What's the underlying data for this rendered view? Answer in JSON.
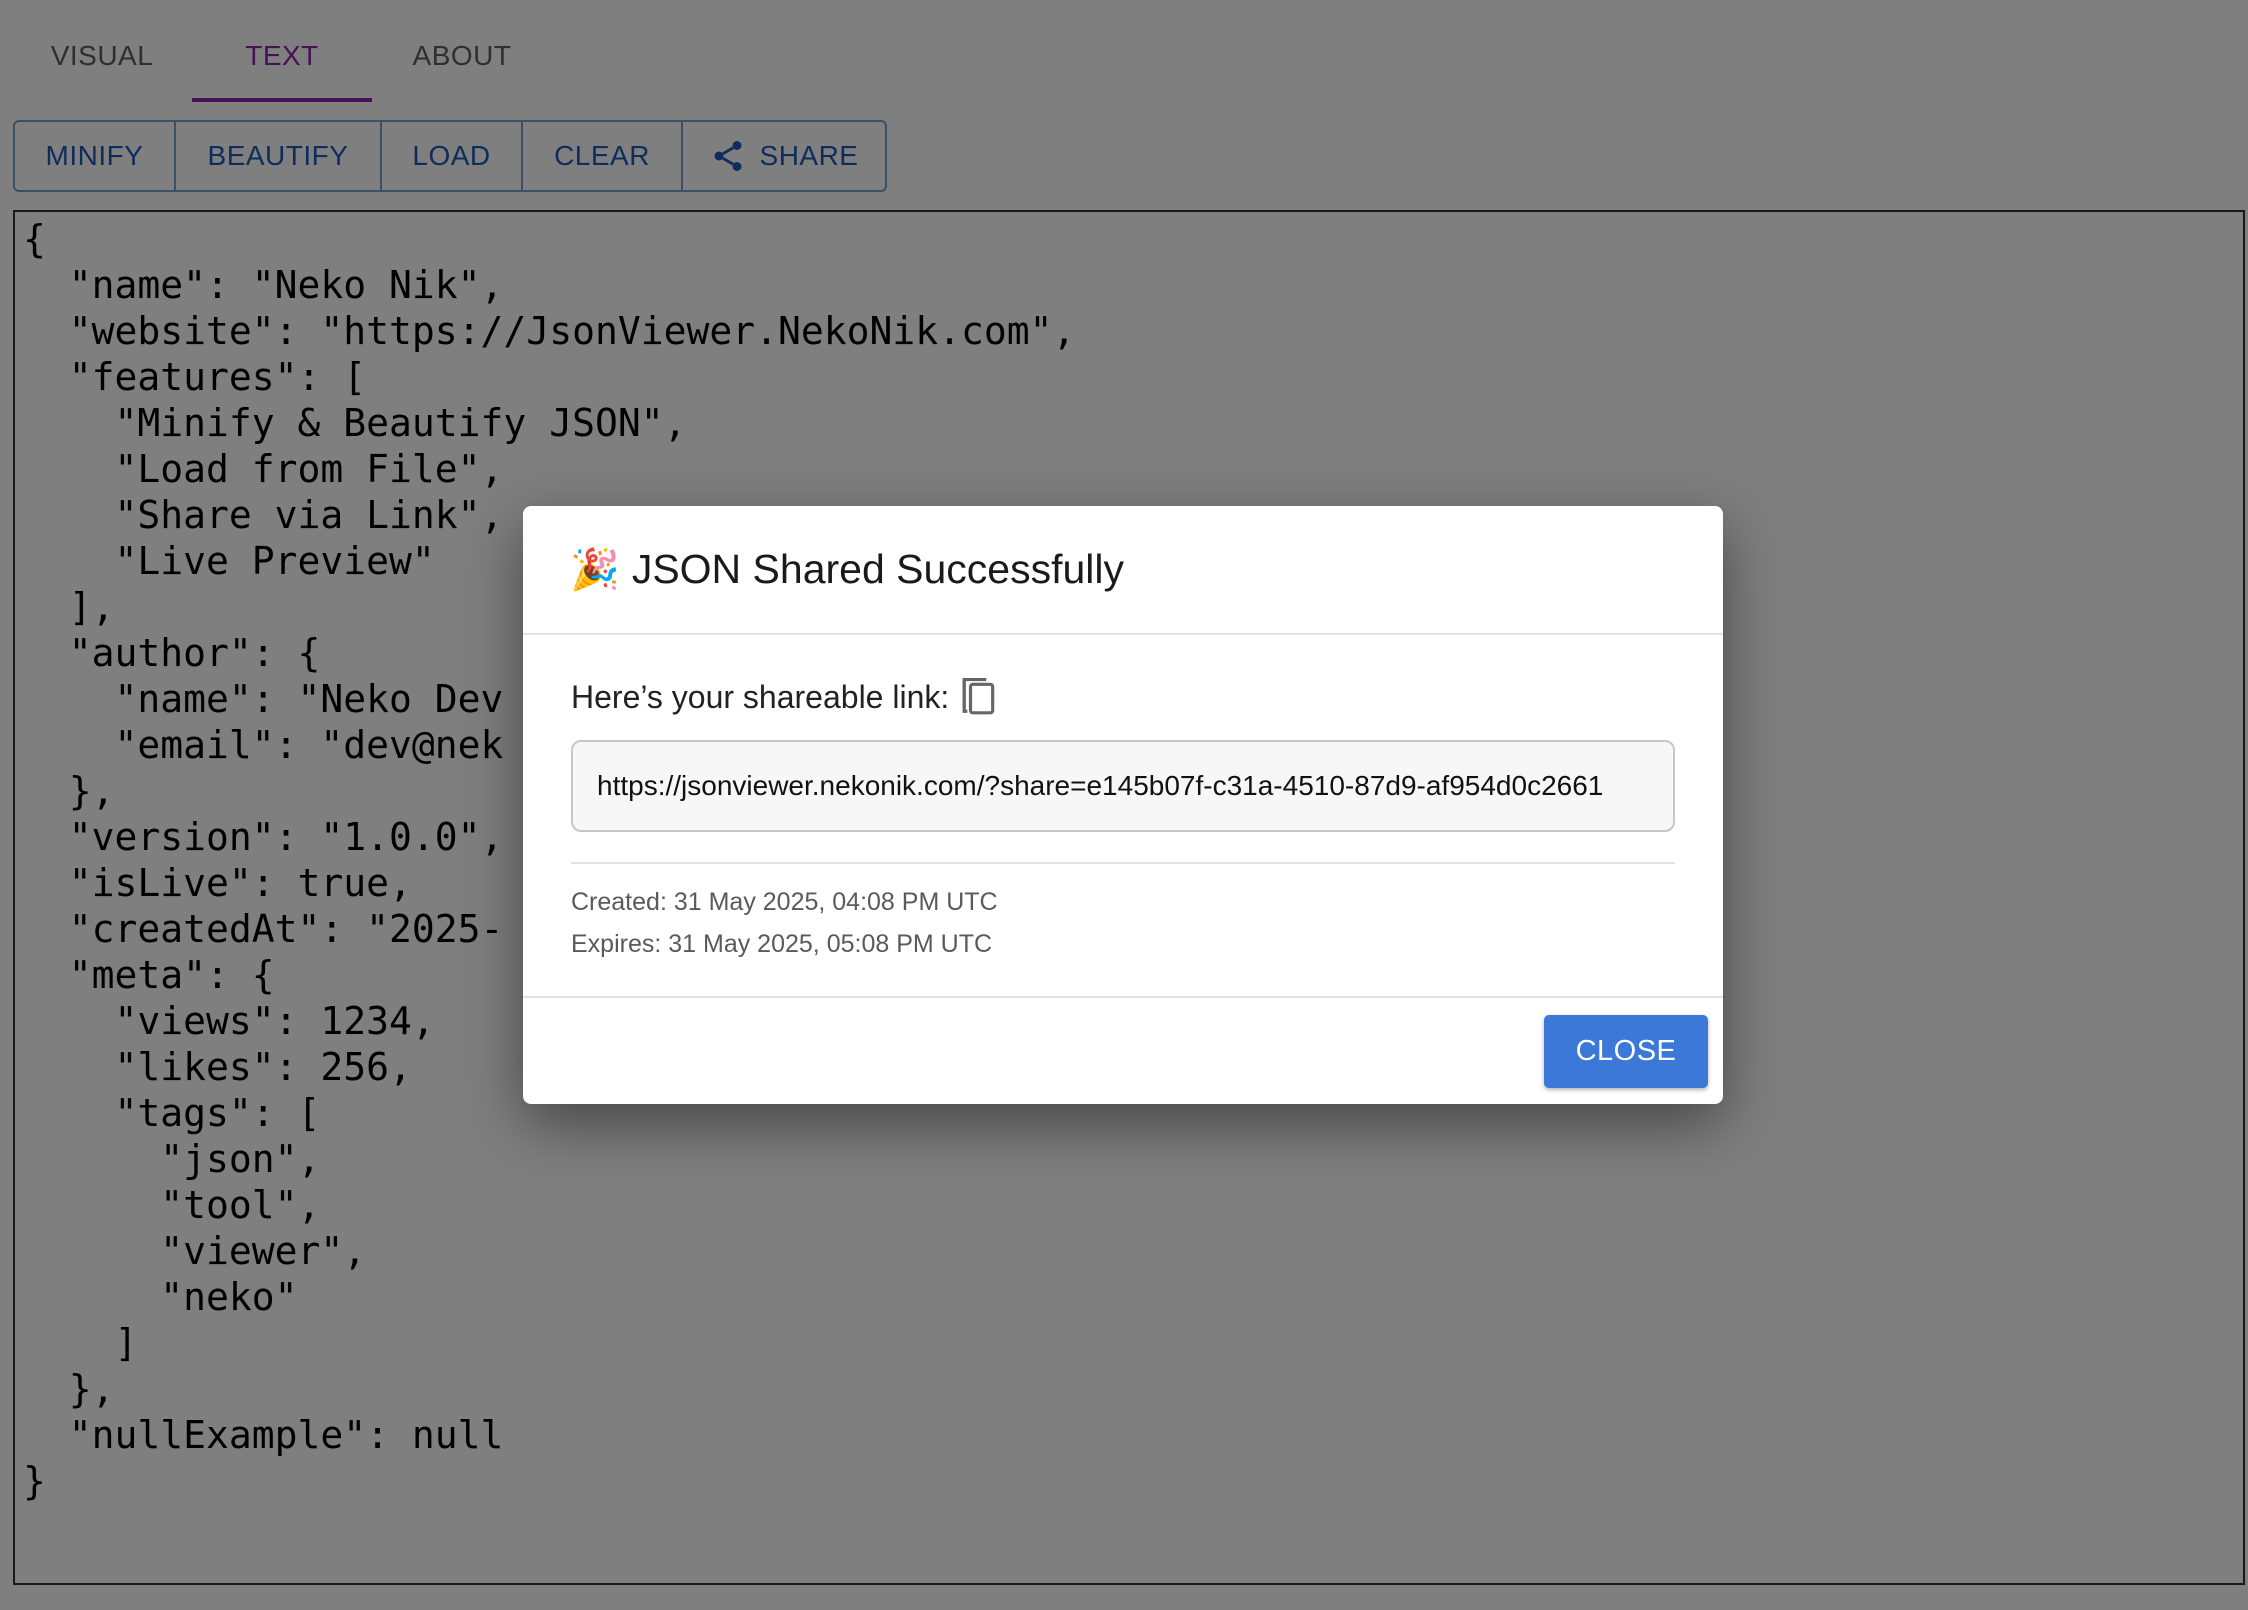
{
  "tabs": [
    {
      "label": "VISUAL"
    },
    {
      "label": "TEXT",
      "active": true
    },
    {
      "label": "ABOUT"
    }
  ],
  "toolbar": {
    "minify_label": "MINIFY",
    "beautify_label": "BEAUTIFY",
    "load_label": "LOAD",
    "clear_label": "CLEAR",
    "share_label": "SHARE",
    "share_icon": "share-icon"
  },
  "editor": {
    "content": "{\n  \"name\": \"Neko Nik\",\n  \"website\": \"https://JsonViewer.NekoNik.com\",\n  \"features\": [\n    \"Minify & Beautify JSON\",\n    \"Load from File\",\n    \"Share via Link\",\n    \"Live Preview\"\n  ],\n  \"author\": {\n    \"name\": \"Neko Dev\n    \"email\": \"dev@nek\n  },\n  \"version\": \"1.0.0\",\n  \"isLive\": true,\n  \"createdAt\": \"2025-\n  \"meta\": {\n    \"views\": 1234,\n    \"likes\": 256,\n    \"tags\": [\n      \"json\",\n      \"tool\",\n      \"viewer\",\n      \"neko\"\n    ]\n  },\n  \"nullExample\": null\n}"
  },
  "dialog": {
    "emoji": "🎉",
    "title": "JSON Shared Successfully",
    "link_label": "Here’s your shareable link:",
    "copy_icon": "copy-icon",
    "link_value": "https://jsonviewer.nekonik.com/?share=e145b07f-c31a-4510-87d9-af954d0c2661",
    "created": "Created: 31 May 2025, 04:08 PM UTC",
    "expires": "Expires: 31 May 2025, 05:08 PM UTC",
    "close_label": "CLOSE"
  },
  "colors": {
    "accent_tab": "#8e24aa",
    "toolbar_text": "#1e5bb8",
    "primary_button": "#3b78d8",
    "overlay": "rgba(0,0,0,0.5)"
  }
}
